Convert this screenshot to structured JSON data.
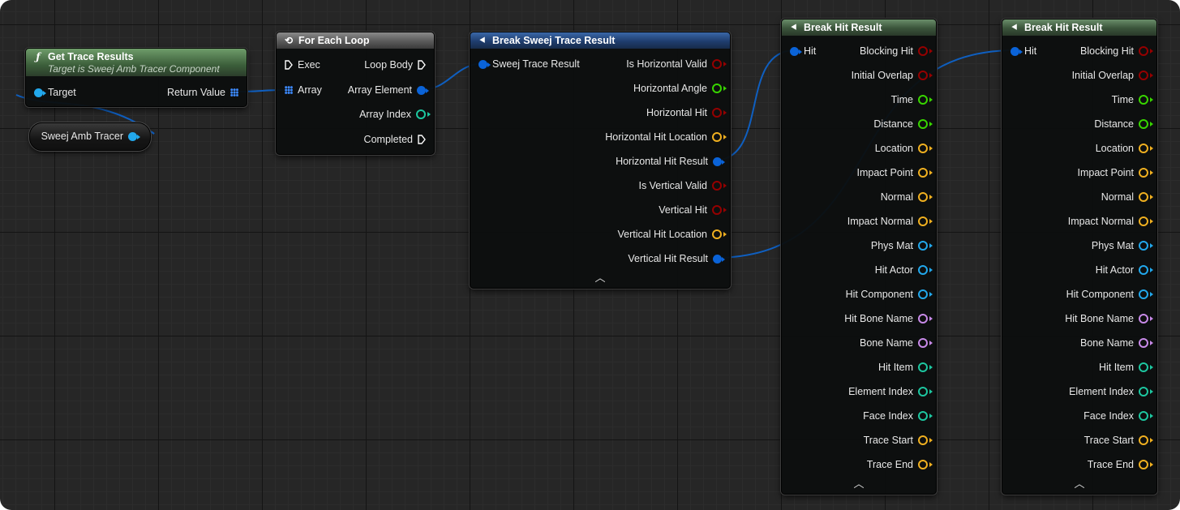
{
  "graph": {
    "var_node": {
      "label": "Sweej Amb Tracer"
    },
    "get_trace_results": {
      "title": "Get Trace Results",
      "subtitle": "Target is Sweej Amb Tracer Component",
      "icon": "function-icon",
      "inputs": [
        "Target"
      ],
      "outputs": [
        "Return Value"
      ]
    },
    "for_each_loop": {
      "title": "For Each Loop",
      "icon": "loop-icon",
      "inputs": [
        "Exec",
        "Array"
      ],
      "outputs": [
        "Loop Body",
        "Array Element",
        "Array Index",
        "Completed"
      ]
    },
    "break_trace_result": {
      "title": "Break Sweej Trace Result",
      "icon": "break-struct-icon",
      "inputs": [
        "Sweej Trace Result"
      ],
      "outputs": [
        "Is Horizontal Valid",
        "Horizontal Angle",
        "Horizontal Hit",
        "Horizontal Hit Location",
        "Horizontal Hit Result",
        "Is Vertical Valid",
        "Vertical Hit",
        "Vertical Hit Location",
        "Vertical Hit Result"
      ]
    },
    "break_hit_result_1": {
      "title": "Break Hit Result",
      "icon": "break-struct-icon",
      "inputs": [
        "Hit"
      ],
      "outputs": [
        "Blocking Hit",
        "Initial Overlap",
        "Time",
        "Distance",
        "Location",
        "Impact Point",
        "Normal",
        "Impact Normal",
        "Phys Mat",
        "Hit Actor",
        "Hit Component",
        "Hit Bone Name",
        "Bone Name",
        "Hit Item",
        "Element Index",
        "Face Index",
        "Trace Start",
        "Trace End"
      ]
    },
    "break_hit_result_2": {
      "title": "Break Hit Result",
      "icon": "break-struct-icon",
      "inputs": [
        "Hit"
      ],
      "outputs": [
        "Blocking Hit",
        "Initial Overlap",
        "Time",
        "Distance",
        "Location",
        "Impact Point",
        "Normal",
        "Impact Normal",
        "Phys Mat",
        "Hit Actor",
        "Hit Component",
        "Hit Bone Name",
        "Bone Name",
        "Hit Item",
        "Element Index",
        "Face Index",
        "Trace Start",
        "Trace End"
      ]
    },
    "colors": {
      "background": "#262626",
      "wire": "#0f5fc0",
      "bool_pin": "#950000",
      "float_pin": "#38d500",
      "vector_pin": "#f0b020",
      "struct_pin": "#0a63d8",
      "object_pin": "#22a8ec",
      "name_pin": "#c88ae8",
      "int_pin": "#1dc7a0",
      "exec_pin": "#ffffff"
    }
  }
}
